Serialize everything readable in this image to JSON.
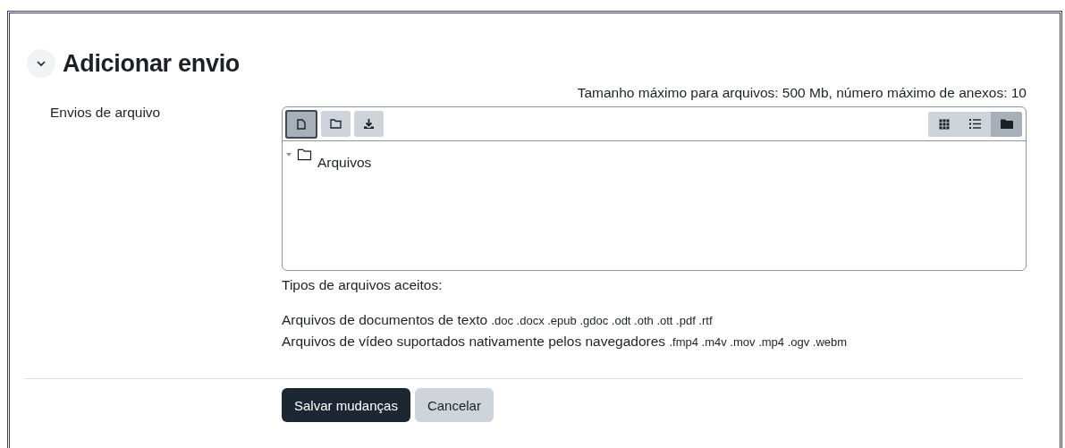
{
  "section": {
    "title": "Adicionar envio",
    "expanded": true
  },
  "field": {
    "label": "Envios de arquivo",
    "limits": "Tamanho máximo para arquivos: 500 Mb, número máximo de anexos: 10"
  },
  "toolbar": [
    {
      "kind": "file",
      "selected": true
    },
    {
      "kind": "folder",
      "selected": false
    },
    {
      "kind": "download",
      "selected": false
    }
  ],
  "views": [
    {
      "kind": "grid",
      "selected": false
    },
    {
      "kind": "list",
      "selected": false
    },
    {
      "kind": "tree",
      "selected": true
    }
  ],
  "tree": [
    {
      "label": "Arquivos",
      "expanded": true
    }
  ],
  "accepted": {
    "label": "Tipos de arquivos aceitos:",
    "types": [
      {
        "name": "Arquivos de documentos de texto",
        "extensions": ".doc .docx .epub .gdoc .odt .oth .ott .pdf .rtf"
      },
      {
        "name": "Arquivos de vídeo suportados nativamente pelos navegadores",
        "extensions": ".fmp4 .m4v .mov .mp4 .ogv .webm"
      }
    ]
  },
  "buttons": [
    {
      "label": "Salvar mudanças",
      "kind": "primary"
    },
    {
      "label": "Cancelar",
      "kind": "secondary"
    }
  ]
}
